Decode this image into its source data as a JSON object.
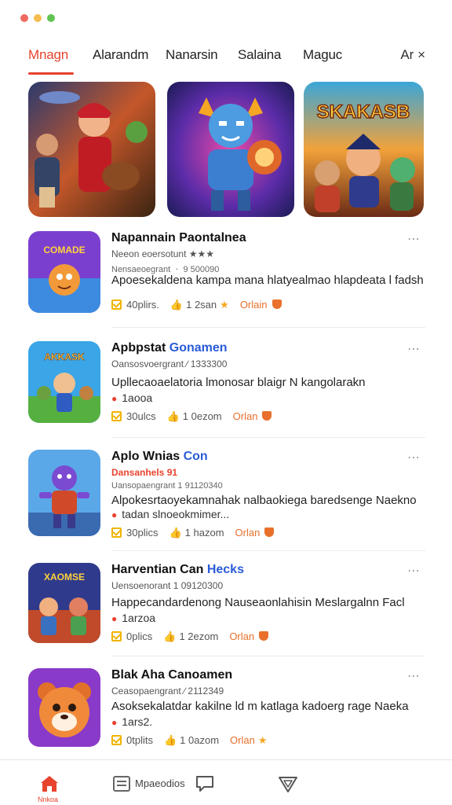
{
  "tabs": [
    {
      "label": "Mnagn",
      "active": true
    },
    {
      "label": "Alarandm",
      "active": false
    },
    {
      "label": "Nanarsin",
      "active": false
    },
    {
      "label": "Salaina",
      "active": false
    },
    {
      "label": "Maguc",
      "active": false
    },
    {
      "label": "Ar ×",
      "active": false
    }
  ],
  "banners": [
    {
      "icon": "warrior-hero-art"
    },
    {
      "icon": "blue-robot-hero-art"
    },
    {
      "icon": "team-heroes-art",
      "text": "SKAKASB"
    }
  ],
  "items": [
    {
      "title": "Napannain Paontalnea",
      "title_accent": "",
      "sub": "Neeon eoersotunt ★★★",
      "meta": "Nensaeoegrant ㆍ 9 500090",
      "desc": "Apoesekaldena kampa mana hlatyealmao hlapdeata l fadsh",
      "desc2": "",
      "stat1": "40plirs.",
      "stat2": "1 2san",
      "origin": "Orlain",
      "thumb_text": "COMADE"
    },
    {
      "title": "Apbpstat ",
      "title_accent": "Gonamen",
      "sub": "Oansosvoergrant ∕ 1333300",
      "meta": "",
      "desc": "Upllecaoaelatoria lmonosar blaigr N kangolarakn",
      "desc2": "1aooa",
      "stat1": "30ulcs",
      "stat2": "1 0ezom",
      "origin": "Orlan",
      "thumb_text": "AKKASK"
    },
    {
      "title": "Aplo Wnias ",
      "title_accent": "Con",
      "sub": "Dansanhels 91",
      "meta": "Uansopaengrant 1 91120340",
      "desc": "Alpokesrtaoyekamnahak nalbaokiega baredsenge Naekno",
      "desc2": "tadan slnoeokmimer...",
      "stat1": "30plics",
      "stat2": "1 hazom",
      "origin": "Orlan",
      "thumb_text": ""
    },
    {
      "title": "Harventian Can ",
      "title_accent": "Hecks",
      "sub": "Uensoenorant 1 09120300",
      "meta": "",
      "desc": "Happecandardenong Nauseaonlahisin Meslargalnn Facl",
      "desc2": "1arzoa",
      "stat1": "0plics",
      "stat2": "1 2ezom",
      "origin": "Orlan",
      "thumb_text": "XAOMSE"
    },
    {
      "title": "Blak Aha Canoamen",
      "title_accent": "",
      "sub": "Ceasopaengrant ∕ 2112349",
      "meta": "",
      "desc": "Asoksekalatdar kakilne ld m katlaga kadoerg rage Naeka",
      "desc2": "1ars2.",
      "stat1": "0tplits",
      "stat2": "1 0azom",
      "origin": "Orlan",
      "thumb_text": ""
    }
  ],
  "bottom_nav": {
    "home_label": "Nnkoa",
    "news_label": "Mpaeodios"
  },
  "colors": {
    "accent": "#e8432e",
    "link": "#2a5bd7",
    "origin": "#e8702a"
  }
}
